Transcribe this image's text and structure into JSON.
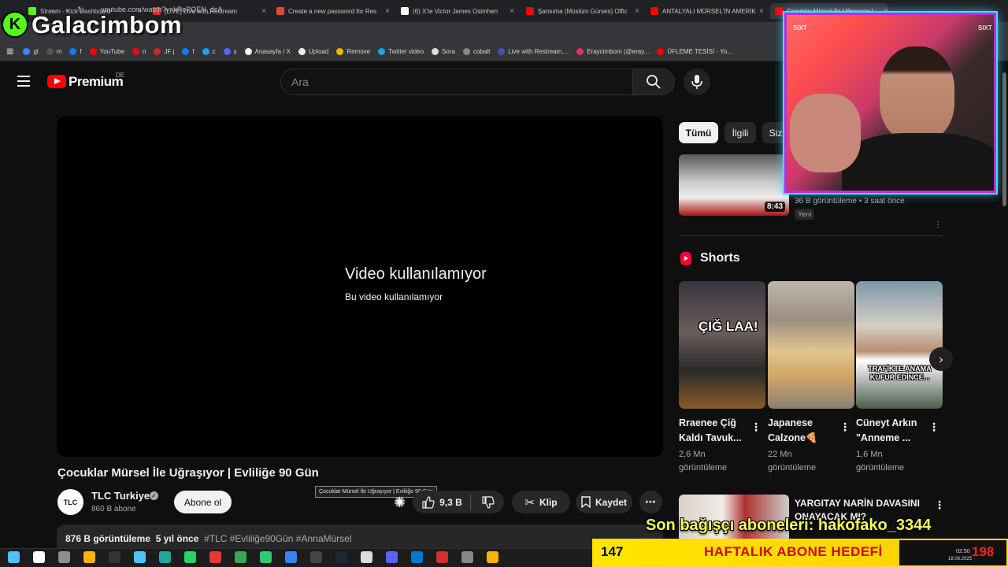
{
  "browser": {
    "tabs": [
      {
        "title": "Stream - Kick Dashboard",
        "color": "#53fc18"
      },
      {
        "title": "[LIVE] Live with Restream",
        "color": "#d93025"
      },
      {
        "title": "Create a new password for Res",
        "color": "#ea4335"
      },
      {
        "title": "(6) X'te Victor James Osimhen",
        "color": "#ffffff"
      },
      {
        "title": "Şansıma (Müslüm Gürses) Offic",
        "color": "#ff0000"
      },
      {
        "title": "ANTALYALI MÜRSEL'İN AMERİK",
        "color": "#ff0000"
      },
      {
        "title": "Çocuklar Mürsel İle Uğraşıyor |",
        "color": "#ff0000"
      }
    ],
    "url": "youtube.com/watch?v=kRoPQEN_dcA",
    "bookmarks": [
      {
        "label": "gl",
        "color": "#4285f4"
      },
      {
        "label": "m",
        "color": "#555555"
      },
      {
        "label": "f",
        "color": "#1877f2"
      },
      {
        "label": "YouTube",
        "color": "#ff0000"
      },
      {
        "label": "n",
        "color": "#e50914"
      },
      {
        "label": "JF j",
        "color": "#c62828"
      },
      {
        "label": "f",
        "color": "#1877f2"
      },
      {
        "label": "c",
        "color": "#1da1f2"
      },
      {
        "label": "s",
        "color": "#5865f2"
      },
      {
        "label": "Anasayfa / X",
        "color": "#ffffff"
      },
      {
        "label": "Upload",
        "color": "#eeeeee"
      },
      {
        "label": "Remove",
        "color": "#f4b400"
      },
      {
        "label": "Twitter video",
        "color": "#1da1f2"
      },
      {
        "label": "Sora",
        "color": "#dddddd"
      },
      {
        "label": "cobalt",
        "color": "#888888"
      },
      {
        "label": "Live with Restream,...",
        "color": "#3f51b5"
      },
      {
        "label": "Eraycimbom (@eray...",
        "color": "#e1306c"
      },
      {
        "label": "ÜFLEME TESİSİ - Yo...",
        "color": "#ff0000"
      }
    ]
  },
  "stream_overlay": {
    "channel_name": "Galacimbom",
    "kick_letter": "K",
    "webcam_sign": "SIXT",
    "donor_line": "Son bağışçı aboneleri: hakofako_3344",
    "goal_current": "147",
    "goal_label": "HAFTALIK ABONE HEDEFİ",
    "goal_target": "198",
    "goal_progress": 0.74
  },
  "youtube": {
    "logo_text": "Premium",
    "region": "DE",
    "search_placeholder": "Ara",
    "player": {
      "unavailable_title": "Video kullanılamıyor",
      "unavailable_sub": "Bu video kullanılamıyor"
    },
    "video_title": "Çocuklar Mürsel İle Uğraşıyor | Evliliğe 90 Gün",
    "tooltip": "Çocuklar Mürsel İle Uğraşıyor | Evliliğe 90 Gün",
    "channel": {
      "avatar_text": "TLC",
      "name": "TLC Turkiye",
      "subs": "860 B abone",
      "subscribe_label": "Abone ol"
    },
    "actions": {
      "likes": "9,3 B",
      "clip": "Klip",
      "save": "Kaydet"
    },
    "description": {
      "views": "876 B görüntüleme",
      "age": "5 yıl önce",
      "tags": "#TLC #Evliliğe90Gün #AnnaMürsel"
    },
    "chips": [
      "Tümü",
      "İlgili",
      "Siz"
    ],
    "rec_top": {
      "duration": "8:43",
      "meta": "36 B görüntüleme • 3 saat önce",
      "badge": "Yeni"
    },
    "shorts_heading": "Shorts",
    "shorts": [
      {
        "title": "Rraenee Çiğ Kaldı Tavuk...",
        "views": "2,6 Mn görüntüleme",
        "caption": "ÇIĞ LAA!"
      },
      {
        "title": "Japanese Calzone🍕",
        "views": "22 Mn görüntüleme",
        "caption": ""
      },
      {
        "title": "Cüneyt Arkın \"Anneme ...",
        "views": "1,6 Mn görüntüleme",
        "caption": "TRAFİKTE ANAMA KÜFÜR EDİNCE..."
      }
    ],
    "rec_bottom": {
      "title": "YARGITAY NARİN DAVASINI ONAYACAK MI?"
    }
  },
  "taskbar": {
    "time": "02:50",
    "date": "18.08.2025"
  }
}
